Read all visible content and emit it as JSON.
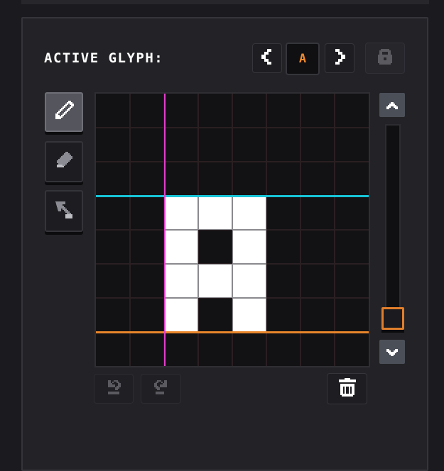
{
  "header": {
    "title": "ACTIVE GLYPH:",
    "current_glyph": "A"
  },
  "header_buttons": {
    "prev_icon": "chevron-left-icon",
    "next_icon": "chevron-right-icon",
    "lock_icon": "lock-icon"
  },
  "tools": [
    {
      "name": "pencil",
      "icon": "pencil-icon",
      "active": true
    },
    {
      "name": "eraser",
      "icon": "eraser-icon",
      "active": false
    },
    {
      "name": "select",
      "icon": "select-icon",
      "active": false
    }
  ],
  "canvas": {
    "columns": 8,
    "rows": 8,
    "filled_cells": [
      [
        3,
        2
      ],
      [
        3,
        3
      ],
      [
        3,
        4
      ],
      [
        4,
        2
      ],
      [
        4,
        4
      ],
      [
        5,
        2
      ],
      [
        5,
        3
      ],
      [
        5,
        4
      ],
      [
        6,
        2
      ],
      [
        6,
        4
      ]
    ],
    "guides": {
      "cap_height_color": "#18c4d8",
      "baseline_color": "#e8852a",
      "left_margin_color": "#e23fc9"
    }
  },
  "scrollbar": {
    "up_icon": "chevron-up-icon",
    "down_icon": "chevron-down-icon",
    "thumb_color": "#e07e2b",
    "position": 1.0
  },
  "bottom_actions": {
    "undo_icon": "undo-icon",
    "redo_icon": "redo-icon",
    "delete_icon": "trash-icon"
  },
  "colors": {
    "accent": "#f28a2c",
    "panel": "#232327",
    "pixel_on": "#ffffff",
    "pixel_off": "#121214"
  }
}
